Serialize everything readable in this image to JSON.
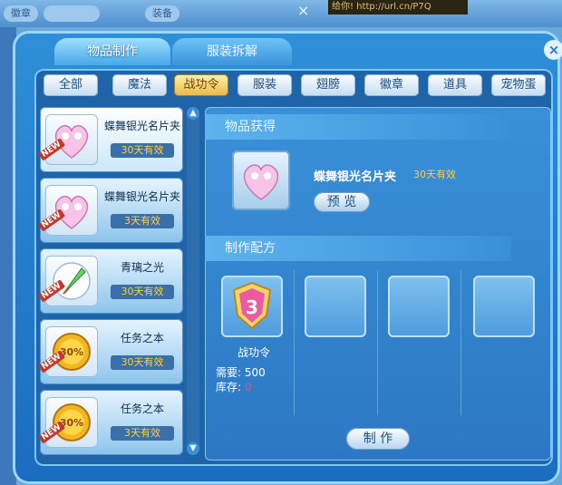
{
  "background": {
    "chips": [
      "徽章",
      "",
      "装备"
    ],
    "ad_text": "给你! http://url.cn/P7Q"
  },
  "window": {
    "tabs": [
      {
        "label": "物品制作",
        "active": true
      },
      {
        "label": "服装拆解",
        "active": false
      }
    ],
    "close_glyph": "×"
  },
  "categories": [
    {
      "label": "全部",
      "active": false
    },
    {
      "label": "魔法",
      "active": false
    },
    {
      "label": "战功令",
      "active": true
    },
    {
      "label": "服装",
      "active": false
    },
    {
      "label": "翅膀",
      "active": false
    },
    {
      "label": "徽章",
      "active": false
    },
    {
      "label": "道具",
      "active": false
    },
    {
      "label": "宠物蛋",
      "active": false
    }
  ],
  "items": [
    {
      "name": "蝶舞银光名片夹",
      "duration": "30天有效",
      "icon": "heart-icon",
      "badge": "NEW"
    },
    {
      "name": "蝶舞银光名片夹",
      "duration": "3天有效",
      "icon": "heart-icon",
      "badge": "NEW"
    },
    {
      "name": "青璃之光",
      "duration": "30天有效",
      "icon": "feather-icon",
      "badge": "NEW"
    },
    {
      "name": "任务之本",
      "duration": "30天有效",
      "icon": "medal-icon",
      "badge": "NEW",
      "icon_text": "30%"
    },
    {
      "name": "任务之本",
      "duration": "3天有效",
      "icon": "medal-icon",
      "badge": "NEW",
      "icon_text": "30%"
    }
  ],
  "obtained": {
    "title": "物品获得",
    "name": "蝶舞银光名片夹",
    "duration": "30天有效",
    "icon": "heart-icon",
    "preview_label": "预 览"
  },
  "recipe": {
    "title": "制作配方",
    "material_name": "战功令",
    "need_label": "需要:",
    "need_value": "500",
    "stock_label": "库存:",
    "stock_value": "0",
    "icon": "shield-icon",
    "craft_label": "制 作"
  },
  "colors": {
    "accent": "#2f8fd8",
    "duration": "#ffd23a",
    "stock_zero": "#ff4a4a"
  }
}
